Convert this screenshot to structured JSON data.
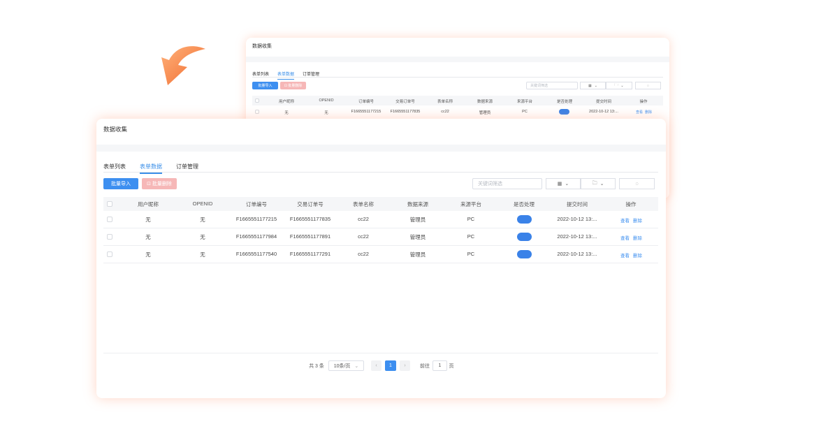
{
  "title": "数据收集",
  "tabs": [
    "表单列表",
    "表单数据",
    "订单管理"
  ],
  "toolbar": {
    "import_label": "批量导入",
    "delete_label": "批量删除",
    "search_placeholder": "关键词筛选"
  },
  "columns": [
    "用户昵称",
    "OPENID",
    "订单编号",
    "交易订单号",
    "表单名称",
    "数据来源",
    "来源平台",
    "是否处理",
    "提交时间",
    "操作"
  ],
  "rows": [
    {
      "nickname": "无",
      "openid": "无",
      "order_no": "F1665551177215",
      "trade_no": "F1665551177835",
      "form": "cc22",
      "source": "管理员",
      "platform": "PC",
      "time": "2022-10-12 13:..."
    },
    {
      "nickname": "无",
      "openid": "无",
      "order_no": "F1665551177984",
      "trade_no": "F1665551177891",
      "form": "cc22",
      "source": "管理员",
      "platform": "PC",
      "time": "2022-10-12 13:..."
    },
    {
      "nickname": "无",
      "openid": "无",
      "order_no": "F1665551177540",
      "trade_no": "F1665551177291",
      "form": "cc22",
      "source": "管理员",
      "platform": "PC",
      "time": "2022-10-12 13:..."
    }
  ],
  "actions": {
    "view": "查看",
    "delete": "删除"
  },
  "pagination": {
    "total": "共 3 条",
    "page_size": "10条/页",
    "current": "1",
    "goto_prefix": "前往",
    "goto_value": "1",
    "goto_suffix": "页"
  },
  "icons": {
    "arrow": "curved-arrow-icon",
    "grid": "grid-icon",
    "folder": "folder-icon",
    "refresh": "refresh-icon",
    "chevron": "chevron-down-icon"
  },
  "colors": {
    "accent": "#3d8ff0",
    "danger": "#f6b7b7",
    "arrow": "#f58a4b"
  }
}
